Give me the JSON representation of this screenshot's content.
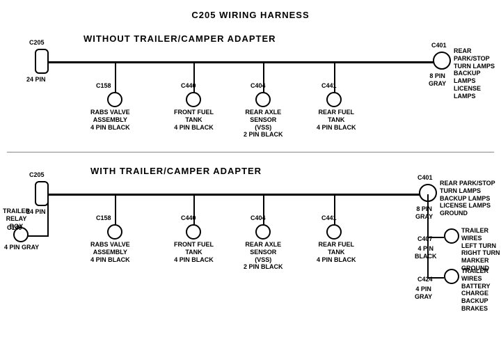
{
  "title": "C205 WIRING HARNESS",
  "section1": {
    "label": "WITHOUT  TRAILER/CAMPER  ADAPTER",
    "left_connector": {
      "id": "C205",
      "pins": "24 PIN"
    },
    "right_connector": {
      "id": "C401",
      "pins": "8 PIN",
      "color": "GRAY",
      "desc": "REAR PARK/STOP\nTURN LAMPS\nBACKUP LAMPS\nLICENSE LAMPS"
    },
    "connectors": [
      {
        "id": "C158",
        "desc": "RABS VALVE\nASSEMBLY\n4 PIN BLACK"
      },
      {
        "id": "C440",
        "desc": "FRONT FUEL\nTANK\n4 PIN BLACK"
      },
      {
        "id": "C404",
        "desc": "REAR AXLE\nSENSOR\n(VSS)\n2 PIN BLACK"
      },
      {
        "id": "C441",
        "desc": "REAR FUEL\nTANK\n4 PIN BLACK"
      }
    ]
  },
  "section2": {
    "label": "WITH  TRAILER/CAMPER  ADAPTER",
    "left_connector": {
      "id": "C205",
      "pins": "24 PIN"
    },
    "right_connector": {
      "id": "C401",
      "pins": "8 PIN",
      "color": "GRAY",
      "desc": "REAR PARK/STOP\nTURN LAMPS\nBACKUP LAMPS\nLICENSE LAMPS\nGROUND"
    },
    "extra_left": {
      "id": "C149",
      "desc": "TRAILER\nRELAY\nBOX",
      "pins": "4 PIN GRAY"
    },
    "connectors": [
      {
        "id": "C158",
        "desc": "RABS VALVE\nASSEMBLY\n4 PIN BLACK"
      },
      {
        "id": "C440",
        "desc": "FRONT FUEL\nTANK\n4 PIN BLACK"
      },
      {
        "id": "C404",
        "desc": "REAR AXLE\nSENSOR\n(VSS)\n2 PIN BLACK"
      },
      {
        "id": "C441",
        "desc": "REAR FUEL\nTANK\n4 PIN BLACK"
      }
    ],
    "right_extras": [
      {
        "id": "C407",
        "pins": "4 PIN\nBLACK",
        "desc": "TRAILER WIRES\nLEFT TURN\nRIGHT TURN\nMARKER\nGROUND"
      },
      {
        "id": "C424",
        "pins": "4 PIN\nGRAY",
        "desc": "TRAILER WIRES\nBATTERY CHARGE\nBACKUP\nBRAKES"
      }
    ]
  }
}
